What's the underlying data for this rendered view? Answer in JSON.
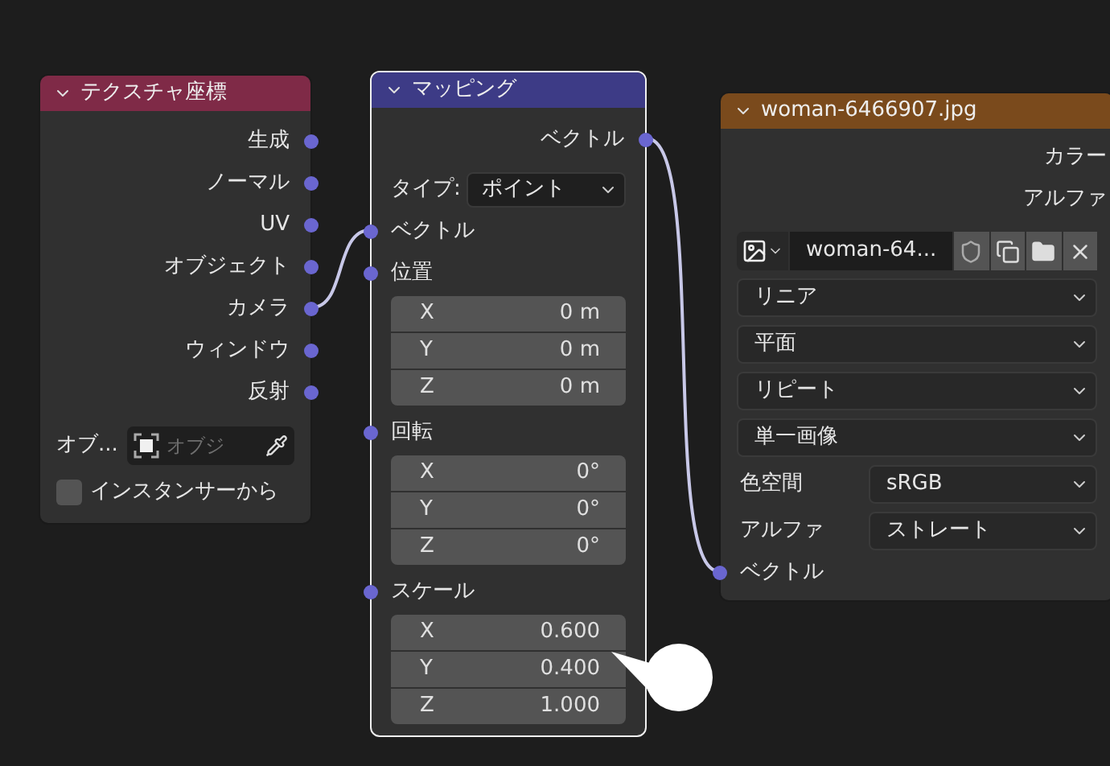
{
  "nodes": [
    {
      "kind": "texture_coordinate",
      "title": "テクスチャ座標",
      "color": "#7f2a47",
      "selected": false,
      "outputs": [
        "生成",
        "ノーマル",
        "UV",
        "オブジェクト",
        "カメラ",
        "ウィンドウ",
        "反射"
      ],
      "object_field": {
        "label": "オブ...",
        "placeholder": "オブジ"
      },
      "checkbox": {
        "label": "インスタンサーから",
        "checked": false
      }
    },
    {
      "kind": "mapping",
      "title": "マッピング",
      "color": "#3d3b86",
      "selected": true,
      "outputs": [
        "ベクトル"
      ],
      "type": {
        "label": "タイプ:",
        "value": "ポイント"
      },
      "inputs": [
        {
          "label": "ベクトル"
        },
        {
          "label": "位置",
          "fields": [
            {
              "axis": "X",
              "value": "0 m"
            },
            {
              "axis": "Y",
              "value": "0 m"
            },
            {
              "axis": "Z",
              "value": "0 m"
            }
          ]
        },
        {
          "label": "回転",
          "fields": [
            {
              "axis": "X",
              "value": "0°"
            },
            {
              "axis": "Y",
              "value": "0°"
            },
            {
              "axis": "Z",
              "value": "0°"
            }
          ]
        },
        {
          "label": "スケール",
          "fields": [
            {
              "axis": "X",
              "value": "0.600"
            },
            {
              "axis": "Y",
              "value": "0.400"
            },
            {
              "axis": "Z",
              "value": "1.000"
            }
          ]
        }
      ]
    },
    {
      "kind": "image_texture",
      "title": "woman-6466907.jpg",
      "color": "#7a4a1c",
      "selected": false,
      "outputs": [
        "カラー",
        "アルファ"
      ],
      "image": {
        "name": "woman-64..."
      },
      "dropdowns": [
        "リニア",
        "平面",
        "リピート",
        "単一画像"
      ],
      "properties": [
        {
          "label": "色空間",
          "value": "sRGB"
        },
        {
          "label": "アルファ",
          "value": "ストレート"
        }
      ],
      "inputs": [
        "ベクトル"
      ]
    }
  ]
}
